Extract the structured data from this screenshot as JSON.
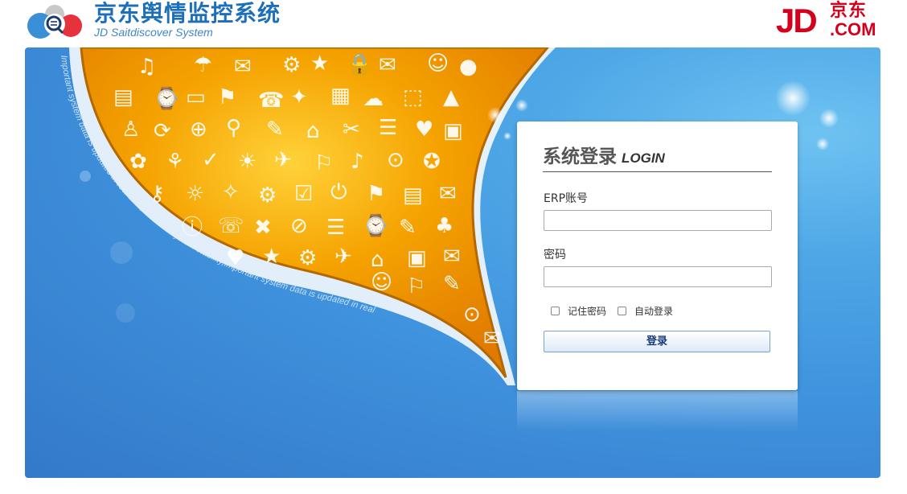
{
  "header": {
    "app_title": "京东舆情监控系统",
    "app_subtitle": "JD Saitdiscover System",
    "logo_icon": "chat-bubble-search-icon",
    "brand_logo": {
      "mark": "JD",
      "cn": "京东",
      "com": ".COM",
      "color": "#d6001c"
    }
  },
  "banner": {
    "curved_text": "Important system data is updated in real time,Powerful system stability,Important system data is updated in real",
    "accent_color": "#f5a300",
    "background_color": "#3f92dd"
  },
  "login": {
    "title": "系统登录",
    "title_en": "LOGIN",
    "username_label": "ERP账号",
    "username_value": "",
    "password_label": "密码",
    "password_value": "",
    "remember_label": "记住密码",
    "auto_login_label": "自动登录",
    "submit_label": "登录"
  }
}
